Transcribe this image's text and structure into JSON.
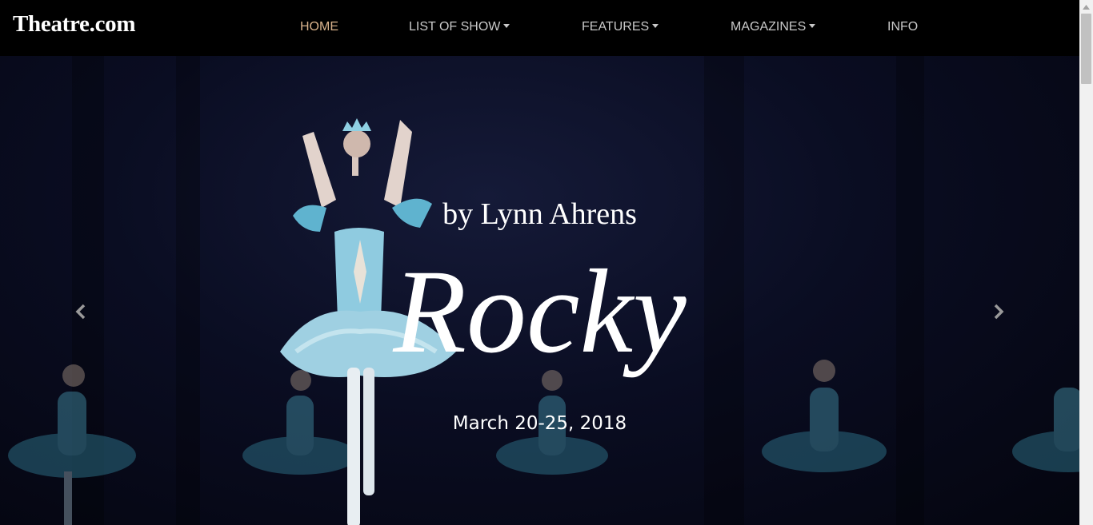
{
  "brand": "Theatre.com",
  "nav": {
    "home": "HOME",
    "list_of_show": "LIST OF SHOW",
    "features": "FEATURES",
    "magazines": "MAGAZINES",
    "info": "INFO"
  },
  "hero": {
    "subtitle": "by Lynn Ahrens",
    "title": "Rocky",
    "dates": "March 20-25, 2018"
  },
  "icons": {
    "prev": "chevron-left-icon",
    "next": "chevron-right-icon",
    "dropdown": "caret-down-icon"
  },
  "colors": {
    "active_nav": "#d9b38c",
    "nav_text": "#c9c9c9",
    "navbar_bg": "#000000"
  }
}
